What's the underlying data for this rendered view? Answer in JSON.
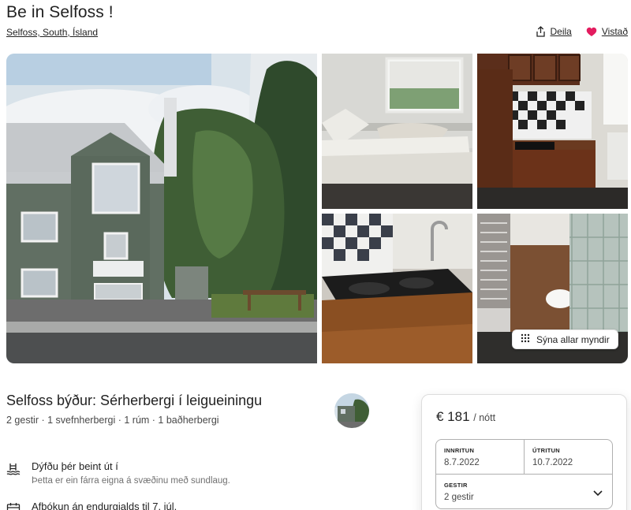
{
  "listing": {
    "title": "Be in Selfoss !",
    "location": "Selfoss, South, Ísland"
  },
  "actions": {
    "share_label": "Deila",
    "save_label": "Vistað",
    "share_icon": "share-icon",
    "save_icon": "heart-icon",
    "heart_color": "#e31c5f"
  },
  "gallery": {
    "show_all_label": "Sýna allar myndir",
    "show_all_icon": "grid-dots-icon"
  },
  "details": {
    "heading": "Selfoss býður: Sérherbergi í leigueiningu",
    "summary": "2 gestir · 1 svefnherbergi · 1 rúm · 1 baðherbergi"
  },
  "features": [
    {
      "icon": "pool-icon",
      "title": "Dýfðu þér beint út í",
      "description": "Þetta er ein fárra eigna á svæðinu með sundlaug."
    },
    {
      "icon": "calendar-icon",
      "title": "Afbókun án endurgjalds til 7. júl.",
      "description": ""
    }
  ],
  "booking": {
    "price": "€ 181",
    "per_label": "/ nótt",
    "checkin_label": "INNRITUN",
    "checkin_value": "8.7.2022",
    "checkout_label": "ÚTRITUN",
    "checkout_value": "10.7.2022",
    "guests_label": "GESTIR",
    "guests_value": "2 gestir"
  }
}
